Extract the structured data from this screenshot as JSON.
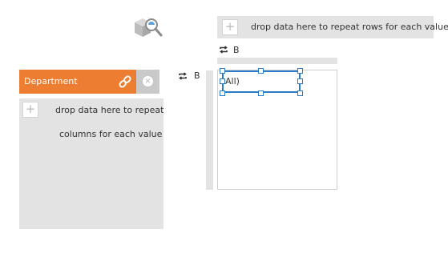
{
  "row_drop_zone": {
    "plus": "+",
    "text": "drop data here to repeat rows for each value"
  },
  "top_repeat": {
    "label": "B",
    "icon": "repeat-icon"
  },
  "left_repeat": {
    "label": "B",
    "icon": "repeat-icon"
  },
  "canvas": {
    "cell_text": "All)"
  },
  "department_panel": {
    "label": "Department",
    "link_icon": "link-icon",
    "remove_icon": "close-icon",
    "remove_glyph": "×",
    "accent_color": "#ed7d31"
  },
  "column_drop_zone": {
    "plus": "+",
    "line1": "drop data here to repeat",
    "line2": "columns for each value"
  },
  "explore_icon": "package-search-icon"
}
